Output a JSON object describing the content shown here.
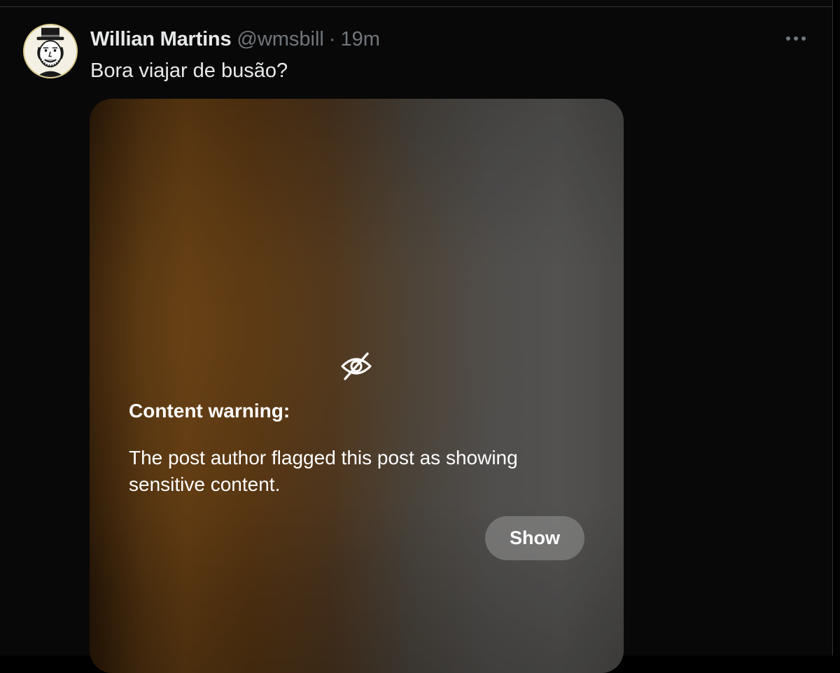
{
  "post": {
    "author_name": "Willian Martins",
    "author_handle": "@wmsbill",
    "separator": "·",
    "time": "19m",
    "text": "Bora viajar de busão?"
  },
  "media": {
    "warning_title": "Content warning:",
    "warning_body": "The post author flagged this post as showing sensitive content.",
    "show_label": "Show",
    "icon": "eye-slash-icon"
  },
  "colors": {
    "background": "#080808",
    "text_primary": "#e7e9ea",
    "text_secondary": "#71767b",
    "divider": "#2f3336"
  }
}
